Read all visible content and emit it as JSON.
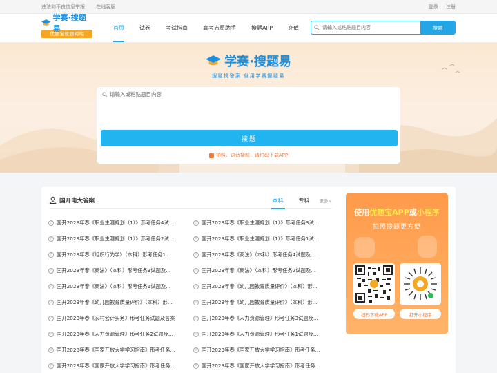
{
  "topbar": {
    "left": [
      "违法和不良信息举报",
      "在线客服"
    ],
    "login": "登录",
    "register": "注册"
  },
  "logo": {
    "brand": "学赛·搜题易",
    "sub": "优题宝就题网站"
  },
  "nav": [
    "首页",
    "试卷",
    "考试指南",
    "高考志愿助手",
    "搜题APP",
    "充值"
  ],
  "header_search": {
    "placeholder": "请输入或粘贴题目内容",
    "button": "搜题"
  },
  "hero": {
    "title": "学赛·搜题易",
    "slogan": "搜题找答案  就用学赛搜题易",
    "placeholder": "请输入或粘贴题目内容",
    "button": "搜题",
    "hint": "拍照、语音搜题，请扫码下载APP"
  },
  "section": {
    "title": "国开电大答案",
    "tabs": [
      "本科",
      "专科"
    ],
    "more": "更多>",
    "questions": [
      "国开2023年春《职业生涯规划（1）》形考任务4试...",
      "国开2023年春《职业生涯规划（1）》形考任务3试...",
      "国开2023年春《职业生涯规划（1）》形考任务2试...",
      "国开2023年春《职业生涯规划（1）》形考任务1试...",
      "国开2023年春《组织行为学》（本科）形考任务1...",
      "国开2023年春《商法》（本科）形考任务4试题及...",
      "国开2023年春《商法》（本科）形考任务3试题及...",
      "国开2023年春《商法》（本科）形考任务2试题及...",
      "国开2023年春《商法》（本科）形考任务1试题及...",
      "国开2023年春《幼儿园教育质量评价》（本科）形...",
      "国开2023年春《幼儿园教育质量评价》（本科）形...",
      "国开2023年春《幼儿园教育质量评价》（本科）形...",
      "国开2023年春《农村会计实务》形考任务试题及答案",
      "国开2023年春《人力资源管理》形考任务3试题及...",
      "国开2023年春《人力资源管理》形考任务2试题及...",
      "国开2023年春《人力资源管理》形考任务1试题及...",
      "国开2023年春《国家开放大学学习指南》形考任务...",
      "国开2023年春《国家开放大学学习指南》形考任务...",
      "国开2023年春《国家开放大学学习指南》形考任务...",
      "国开2023年春《国家开放大学学习指南》形考任务..."
    ]
  },
  "promo": {
    "title_pre": "使用",
    "title_hl1": "优题宝APP",
    "title_mid": "或",
    "title_hl2": "小程序",
    "subtitle": "拍照搜题更方便",
    "qr_app": "扫码下载APP",
    "qr_mini": "打开小程序"
  },
  "colors": {
    "accent": "#22a6e8",
    "orange": "#f07a3a",
    "promo": "#ff9a4a"
  }
}
